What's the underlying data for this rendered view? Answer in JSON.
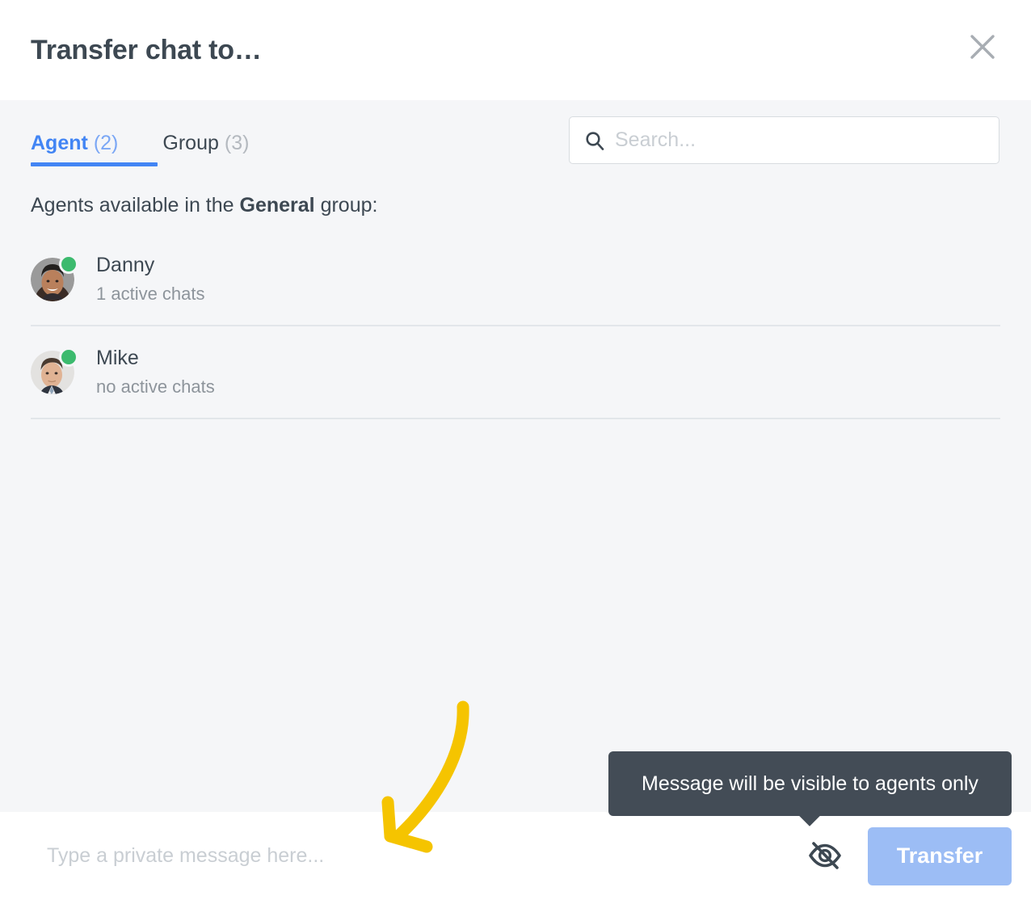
{
  "header": {
    "title": "Transfer chat to…",
    "close_icon": "close-icon"
  },
  "tabs": [
    {
      "label": "Agent",
      "count": "(2)",
      "active": true
    },
    {
      "label": "Group",
      "count": "(3)",
      "active": false
    }
  ],
  "search": {
    "placeholder": "Search...",
    "value": "",
    "icon": "search-icon"
  },
  "body": {
    "caption_prefix": "Agents available in the ",
    "caption_group": "General",
    "caption_suffix": " group:"
  },
  "agents": [
    {
      "name": "Danny",
      "status_text": "1 active chats",
      "presence": "online",
      "presence_color": "#3cba6e"
    },
    {
      "name": "Mike",
      "status_text": "no active chats",
      "presence": "online",
      "presence_color": "#3cba6e"
    }
  ],
  "footer": {
    "message_placeholder": "Type a private message here...",
    "message_value": "",
    "visibility_icon": "eye-off-icon",
    "transfer_label": "Transfer"
  },
  "tooltip": {
    "text": "Message will be visible to agents only",
    "background": "#434c56"
  },
  "annotation": {
    "type": "curved-arrow",
    "color": "#f5c400"
  },
  "colors": {
    "accent": "#4285f4",
    "title": "#3d4852",
    "muted": "#8d949b",
    "panel_bg": "#f5f6f8",
    "surface": "#ffffff",
    "transfer_button": "#9cbdf5",
    "divider": "#e2e6ea"
  }
}
